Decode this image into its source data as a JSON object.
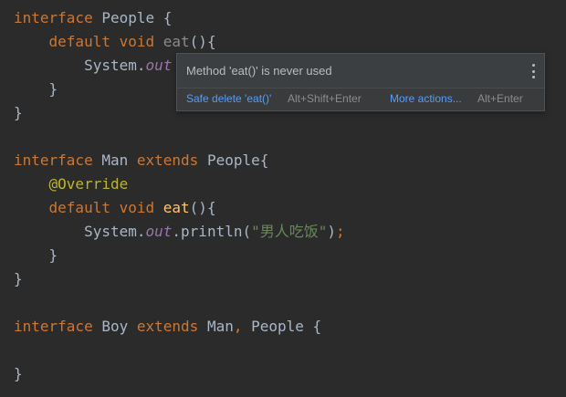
{
  "code": {
    "l1": {
      "kw": "interface",
      "name": " People {"
    },
    "l2": {
      "indent": "    ",
      "kw": "default void",
      "sp": " ",
      "method": "eat",
      "rest": "(){"
    },
    "l3": {
      "indent": "        ",
      "obj": "System.",
      "field": "out"
    },
    "l4": {
      "text": "    }"
    },
    "l5": {
      "text": "}"
    },
    "l7": {
      "kw1": "interface",
      "mid": " Man ",
      "kw2": "extends",
      "rest": " People{"
    },
    "l8": {
      "indent": "    ",
      "annotation": "@Override"
    },
    "l9": {
      "indent": "    ",
      "kw": "default void",
      "sp": " ",
      "method": "eat",
      "rest": "(){"
    },
    "l10": {
      "indent": "        ",
      "obj": "System.",
      "field": "out",
      "call": ".println(",
      "string": "\"男人吃饭\"",
      "close": ")",
      "semi": ";"
    },
    "l11": {
      "text": "    }"
    },
    "l12": {
      "text": "}"
    },
    "l14": {
      "kw1": "interface",
      "mid": " Boy ",
      "kw2": "extends",
      "mid2": " Man",
      "comma": ",",
      "rest": " People {"
    },
    "l16": {
      "text": "}"
    }
  },
  "popup": {
    "message": "Method 'eat()' is never used",
    "more_icon": "kebab-menu-icon",
    "actions": [
      {
        "label": "Safe delete 'eat()'",
        "shortcut": "Alt+Shift+Enter"
      },
      {
        "label": "More actions...",
        "shortcut": "Alt+Enter"
      }
    ]
  },
  "colors": {
    "background": "#2b2b2b",
    "keyword": "#cc7832",
    "annotation": "#bbb529",
    "method_declaration": "#ffc66d",
    "unused_symbol": "#8a8a8a",
    "static_field": "#9876aa",
    "string": "#6a8759",
    "link": "#589df6"
  }
}
